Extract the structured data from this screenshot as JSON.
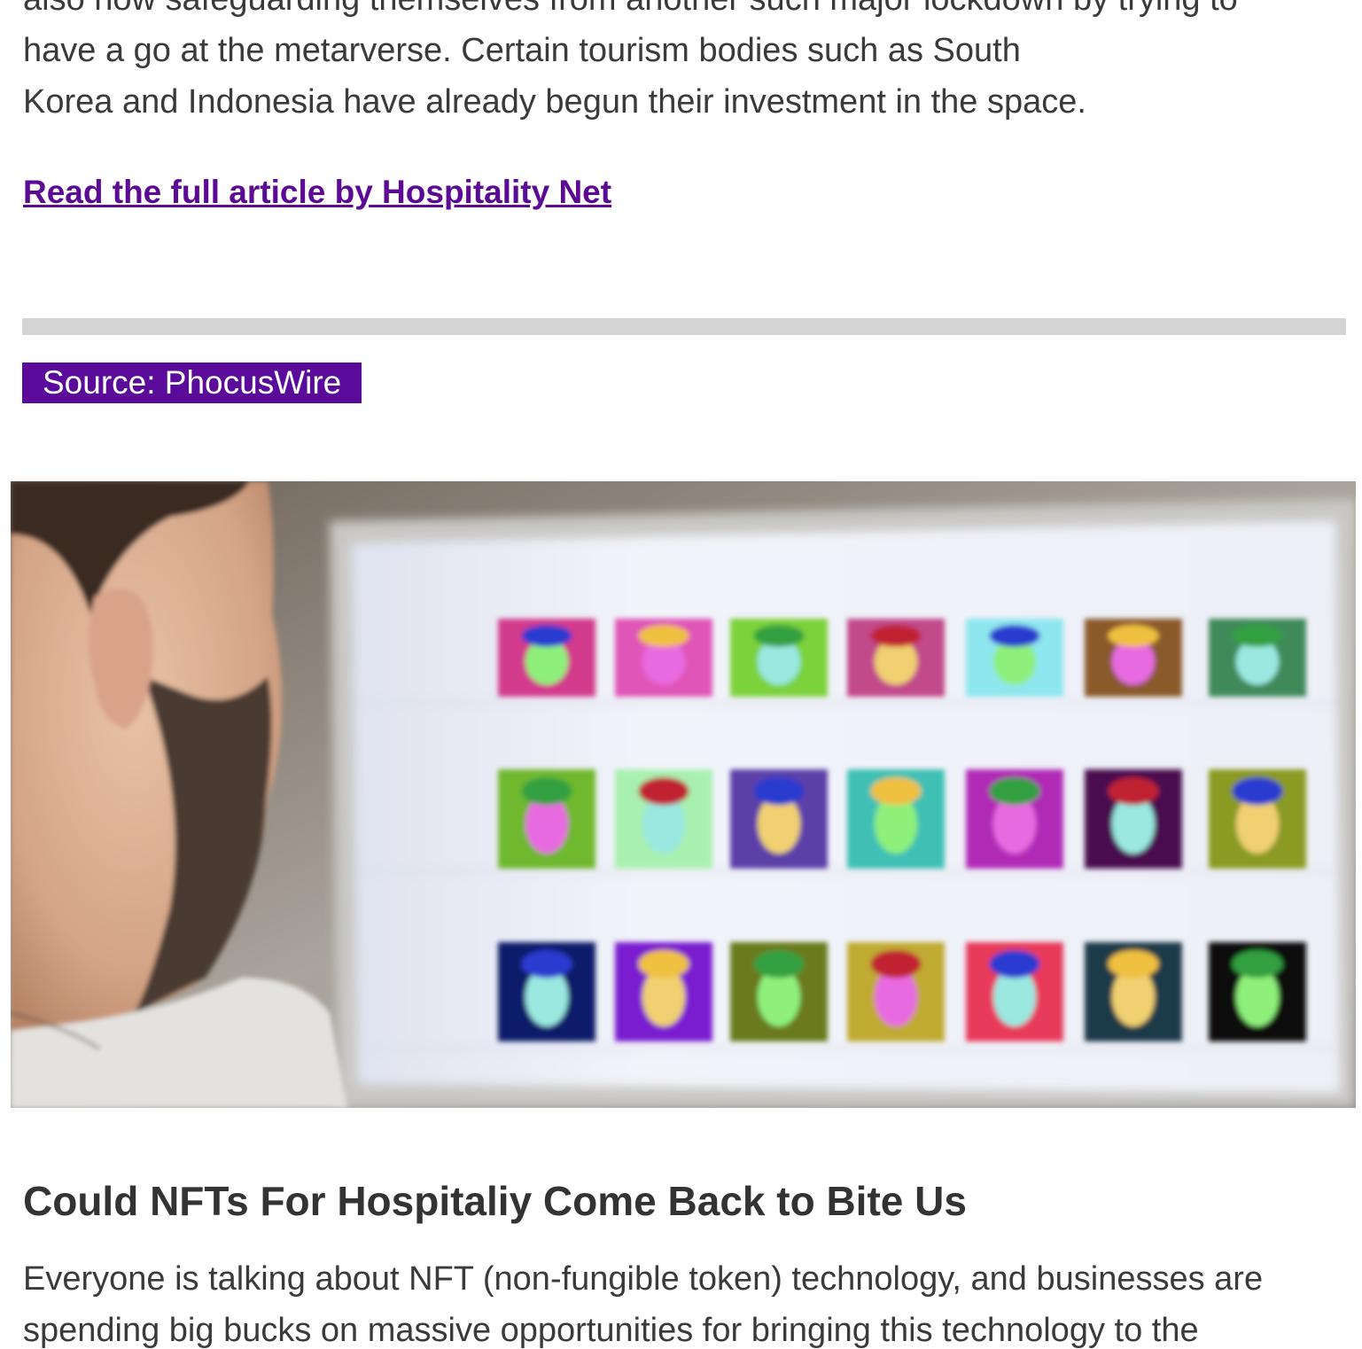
{
  "article_top": {
    "lines": [
      "also now safeguarding themselves from another such major lockdown by trying to",
      "have a go at the metarverse. Certain tourism bodies such as South",
      "Korea and Indonesia have already begun their investment in the space."
    ],
    "link_label": "Read the full article by Hospitality Net"
  },
  "source_badge": "Source: PhocusWire",
  "colors": {
    "accent": "#5b0b99",
    "link": "#5c0a96",
    "divider": "#d4d4d4",
    "text": "#3a3a3a"
  },
  "hero_image": {
    "name": "nft-avatars-monitor-photo",
    "tile_colors": [
      [
        "#d33a8c",
        "#e055b8",
        "#7bd23a",
        "#c24a8a",
        "#8ee6ee",
        "#8a5a2a",
        "#3f8a5a"
      ],
      [
        "#6fb82e",
        "#a8f0b0",
        "#5b3fa8",
        "#3fc0b4",
        "#b02ab6",
        "#4a1050",
        "#8a9a20"
      ],
      [
        "#0d1a6a",
        "#7a1ad0",
        "#6a7a1a",
        "#c0aa30",
        "#e83a5a",
        "#1a3a4a",
        "#101010"
      ]
    ]
  },
  "next_article": {
    "title": "Could NFTs For Hospitaliy Come Back to Bite Us",
    "lines": [
      "Everyone is talking about NFT (non-fungible token) technology, and businesses are",
      "spending big bucks on massive opportunities for bringing this technology to the"
    ]
  }
}
